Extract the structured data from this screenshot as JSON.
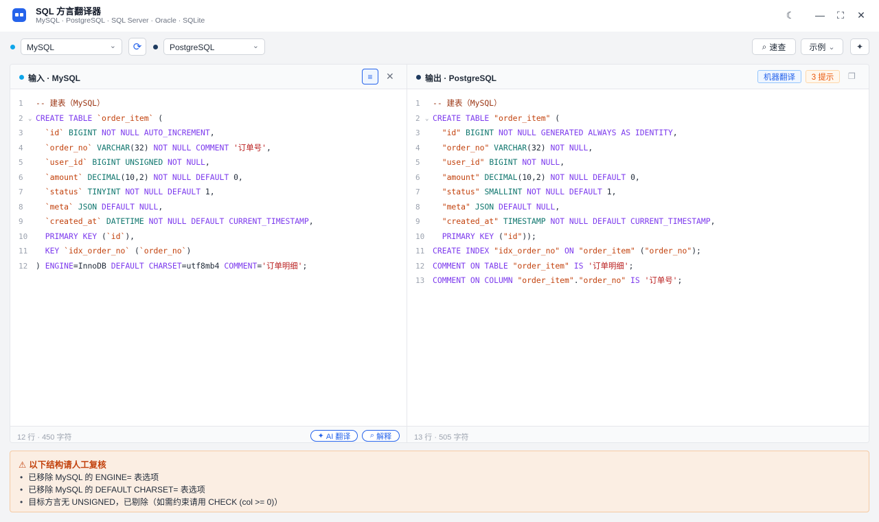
{
  "app": {
    "title": "SQL 方言翻译器",
    "subtitle": "MySQL · PostgreSQL · SQL Server · Oracle · SQLite"
  },
  "window": {
    "theme_icon": "moon-icon",
    "minimize_icon": "minimize-icon",
    "maximize_icon": "maximize-icon",
    "close_icon": "close-icon"
  },
  "toolbar": {
    "source_dialect": "MySQL",
    "target_dialect": "PostgreSQL",
    "source_color": "#0ea5e9",
    "target_color": "#1e3a5f",
    "lookup_label": "速查",
    "examples_label": "示例"
  },
  "input": {
    "title": "输入 · MySQL",
    "stats": "12 行 · 450 字符",
    "ai_label": "AI 翻译",
    "explain_label": "解释",
    "lines": [
      [
        [
          "cm",
          "-- 建表（MySQL）"
        ]
      ],
      [
        [
          "kw",
          "CREATE TABLE "
        ],
        [
          "id",
          "`order_item`"
        ],
        [
          "nm",
          " ("
        ]
      ],
      [
        [
          "nm",
          "  "
        ],
        [
          "id",
          "`id`"
        ],
        [
          "nm",
          " "
        ],
        [
          "ty",
          "BIGINT"
        ],
        [
          "kw",
          " NOT NULL AUTO_INCREMENT"
        ],
        [
          "nm",
          ","
        ]
      ],
      [
        [
          "nm",
          "  "
        ],
        [
          "id",
          "`order_no`"
        ],
        [
          "nm",
          " "
        ],
        [
          "ty",
          "VARCHAR"
        ],
        [
          "nm",
          "(32)"
        ],
        [
          "kw",
          " NOT NULL COMMENT "
        ],
        [
          "st",
          "'订单号'"
        ],
        [
          "nm",
          ","
        ]
      ],
      [
        [
          "nm",
          "  "
        ],
        [
          "id",
          "`user_id`"
        ],
        [
          "nm",
          " "
        ],
        [
          "ty",
          "BIGINT UNSIGNED"
        ],
        [
          "kw",
          " NOT NULL"
        ],
        [
          "nm",
          ","
        ]
      ],
      [
        [
          "nm",
          "  "
        ],
        [
          "id",
          "`amount`"
        ],
        [
          "nm",
          " "
        ],
        [
          "ty",
          "DECIMAL"
        ],
        [
          "nm",
          "(10,2)"
        ],
        [
          "kw",
          " NOT NULL DEFAULT "
        ],
        [
          "nm",
          "0,"
        ]
      ],
      [
        [
          "nm",
          "  "
        ],
        [
          "id",
          "`status`"
        ],
        [
          "nm",
          " "
        ],
        [
          "ty",
          "TINYINT"
        ],
        [
          "kw",
          " NOT NULL DEFAULT "
        ],
        [
          "nm",
          "1,"
        ]
      ],
      [
        [
          "nm",
          "  "
        ],
        [
          "id",
          "`meta`"
        ],
        [
          "nm",
          " "
        ],
        [
          "ty",
          "JSON"
        ],
        [
          "kw",
          " DEFAULT NULL"
        ],
        [
          "nm",
          ","
        ]
      ],
      [
        [
          "nm",
          "  "
        ],
        [
          "id",
          "`created_at`"
        ],
        [
          "nm",
          " "
        ],
        [
          "ty",
          "DATETIME"
        ],
        [
          "kw",
          " NOT NULL DEFAULT CURRENT_TIMESTAMP"
        ],
        [
          "nm",
          ","
        ]
      ],
      [
        [
          "nm",
          "  "
        ],
        [
          "kw",
          "PRIMARY KEY"
        ],
        [
          "nm",
          " ("
        ],
        [
          "id",
          "`id`"
        ],
        [
          "nm",
          "),"
        ]
      ],
      [
        [
          "nm",
          "  "
        ],
        [
          "kw",
          "KEY "
        ],
        [
          "id",
          "`idx_order_no`"
        ],
        [
          "nm",
          " ("
        ],
        [
          "id",
          "`order_no`"
        ],
        [
          "nm",
          ")"
        ]
      ],
      [
        [
          "nm",
          ") "
        ],
        [
          "kw",
          "ENGINE"
        ],
        [
          "nm",
          "=InnoDB "
        ],
        [
          "kw",
          "DEFAULT CHARSET"
        ],
        [
          "nm",
          "=utf8mb4 "
        ],
        [
          "kw",
          "COMMENT"
        ],
        [
          "nm",
          "="
        ],
        [
          "st",
          "'订单明细'"
        ],
        [
          "nm",
          ";"
        ]
      ]
    ]
  },
  "output": {
    "title": "输出 · PostgreSQL",
    "stats": "13 行 · 505 字符",
    "machine_label": "机器翻译",
    "hints_label": "3 提示",
    "lines": [
      [
        [
          "cm",
          "-- 建表（MySQL）"
        ]
      ],
      [
        [
          "kw",
          "CREATE TABLE "
        ],
        [
          "id",
          "\"order_item\""
        ],
        [
          "nm",
          " ("
        ]
      ],
      [
        [
          "nm",
          "  "
        ],
        [
          "id",
          "\"id\""
        ],
        [
          "nm",
          " "
        ],
        [
          "ty",
          "BIGINT"
        ],
        [
          "kw",
          " NOT NULL GENERATED ALWAYS AS IDENTITY"
        ],
        [
          "nm",
          ","
        ]
      ],
      [
        [
          "nm",
          "  "
        ],
        [
          "id",
          "\"order_no\""
        ],
        [
          "nm",
          " "
        ],
        [
          "ty",
          "VARCHAR"
        ],
        [
          "nm",
          "(32)"
        ],
        [
          "kw",
          " NOT NULL"
        ],
        [
          "nm",
          ","
        ]
      ],
      [
        [
          "nm",
          "  "
        ],
        [
          "id",
          "\"user_id\""
        ],
        [
          "nm",
          " "
        ],
        [
          "ty",
          "BIGINT"
        ],
        [
          "kw",
          " NOT NULL"
        ],
        [
          "nm",
          ","
        ]
      ],
      [
        [
          "nm",
          "  "
        ],
        [
          "id",
          "\"amount\""
        ],
        [
          "nm",
          " "
        ],
        [
          "ty",
          "DECIMAL"
        ],
        [
          "nm",
          "(10,2)"
        ],
        [
          "kw",
          " NOT NULL DEFAULT "
        ],
        [
          "nm",
          "0,"
        ]
      ],
      [
        [
          "nm",
          "  "
        ],
        [
          "id",
          "\"status\""
        ],
        [
          "nm",
          " "
        ],
        [
          "ty",
          "SMALLINT"
        ],
        [
          "kw",
          " NOT NULL DEFAULT "
        ],
        [
          "nm",
          "1,"
        ]
      ],
      [
        [
          "nm",
          "  "
        ],
        [
          "id",
          "\"meta\""
        ],
        [
          "nm",
          " "
        ],
        [
          "ty",
          "JSON"
        ],
        [
          "kw",
          " DEFAULT NULL"
        ],
        [
          "nm",
          ","
        ]
      ],
      [
        [
          "nm",
          "  "
        ],
        [
          "id",
          "\"created_at\""
        ],
        [
          "nm",
          " "
        ],
        [
          "ty",
          "TIMESTAMP"
        ],
        [
          "kw",
          " NOT NULL DEFAULT CURRENT_TIMESTAMP"
        ],
        [
          "nm",
          ","
        ]
      ],
      [
        [
          "nm",
          "  "
        ],
        [
          "kw",
          "PRIMARY KEY"
        ],
        [
          "nm",
          " ("
        ],
        [
          "id",
          "\"id\""
        ],
        [
          "nm",
          "));"
        ]
      ],
      [
        [
          "kw",
          "CREATE INDEX "
        ],
        [
          "id",
          "\"idx_order_no\""
        ],
        [
          "kw",
          " ON "
        ],
        [
          "id",
          "\"order_item\""
        ],
        [
          "nm",
          " ("
        ],
        [
          "id",
          "\"order_no\""
        ],
        [
          "nm",
          ");"
        ]
      ],
      [
        [
          "kw",
          "COMMENT ON TABLE "
        ],
        [
          "id",
          "\"order_item\""
        ],
        [
          "kw",
          " IS "
        ],
        [
          "st",
          "'订单明细'"
        ],
        [
          "nm",
          ";"
        ]
      ],
      [
        [
          "kw",
          "COMMENT ON COLUMN "
        ],
        [
          "id",
          "\"order_item\""
        ],
        [
          "nm",
          "."
        ],
        [
          "id",
          "\"order_no\""
        ],
        [
          "kw",
          " IS "
        ],
        [
          "st",
          "'订单号'"
        ],
        [
          "nm",
          ";"
        ]
      ]
    ]
  },
  "warnings": {
    "title": "以下结构请人工复核",
    "items": [
      "已移除 MySQL 的 ENGINE= 表选项",
      "已移除 MySQL 的 DEFAULT CHARSET= 表选项",
      "目标方言无 UNSIGNED，已剔除（如需约束请用 CHECK (col >= 0)）"
    ]
  }
}
